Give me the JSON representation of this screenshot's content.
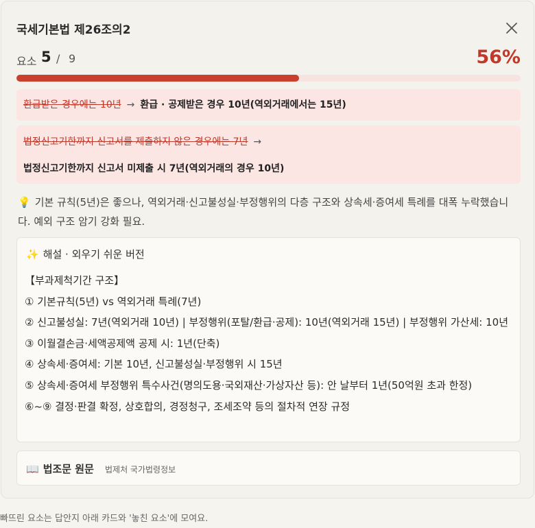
{
  "card": {
    "title": "국세기본법 제26조의2",
    "close_icon": "close-icon"
  },
  "progress": {
    "label": "요소",
    "current": "5",
    "separator": "/",
    "total": "9",
    "percent_text": "56%",
    "fraction": 0.56,
    "fill_color": "#c9402f",
    "track_color": "#f7e3df"
  },
  "corrections": [
    {
      "wrong": "환급받은 경우에는 10년",
      "arrow": "→",
      "right": "환급 · 공제받은 경우 10년(역외거래에서는 15년)"
    },
    {
      "wrong": "법정신고기한까지 신고서를 제출하지 않은 경우에는 7년",
      "arrow": "→",
      "right": "법정신고기한까지 신고서 미제출 시 7년(역외거래의 경우 10년)"
    }
  ],
  "tip": {
    "icon": "💡",
    "text": "기본 규칙(5년)은 좋으나, 역외거래·신고불성실·부정행위의 다층 구조와 상속세·증여세 특례를 대폭 누락했습니다. 예외 구조 암기 강화 필요."
  },
  "explanation": {
    "icon": "✨",
    "title": "해설 · 외우기 쉬운 버전",
    "lines": [
      "【부과제척기간 구조】",
      "① 기본규칙(5년) vs 역외거래 특례(7년)",
      "② 신고불성실: 7년(역외거래 10년) | 부정행위(포탈/환급·공제): 10년(역외거래 15년) | 부정행위 가산세: 10년",
      "③ 이월결손금·세액공제액 공제 시: 1년(단축)",
      "④ 상속세·증여세: 기본 10년, 신고불성실·부정행위 시 15년",
      "⑤ 상속세·증여세 부정행위 특수사건(명의도용·국외재산·가상자산 등): 안 날부터 1년(50억원 초과 한정)",
      "⑥~⑨ 결정·판결 확정, 상호합의, 경정청구, 조세조약 등의 절차적 연장 규정"
    ]
  },
  "law": {
    "icon": "📖",
    "title": "법조문 원문",
    "source": "법제처 국가법령정보"
  },
  "footer": {
    "text": "빠뜨린 요소는 답안지 아래 카드와 '놓친 요소'에 모여요."
  },
  "colors": {
    "accent": "#c0392b",
    "correction_bg": "#fbe6e4"
  }
}
